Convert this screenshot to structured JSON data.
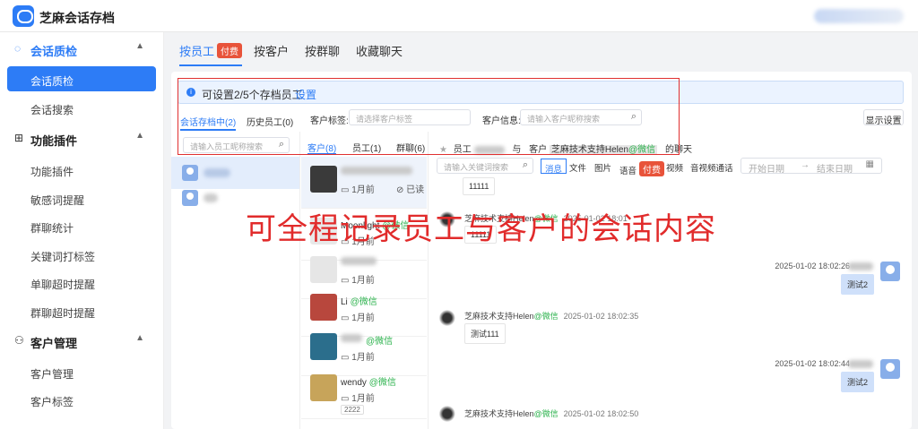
{
  "app": {
    "title": "芝麻会话存档"
  },
  "sidebar": {
    "sections": [
      {
        "label": "会话质检",
        "icon": "chat-icon",
        "items": [
          "会话质检",
          "会话搜索"
        ]
      },
      {
        "label": "功能插件",
        "icon": "grid-icon",
        "items": [
          "功能插件",
          "敏感词提醒",
          "群聊统计",
          "关键词打标签",
          "单聊超时提醒",
          "群聊超时提醒"
        ]
      },
      {
        "label": "客户管理",
        "icon": "user-icon",
        "items": [
          "客户管理",
          "客户标签"
        ]
      }
    ]
  },
  "tabs": [
    {
      "label": "按员工",
      "badge": "付费"
    },
    {
      "label": "按客户"
    },
    {
      "label": "按群聊"
    },
    {
      "label": "收藏聊天"
    }
  ],
  "notice": {
    "text": "可设置2/5个存档员工",
    "link": "设置"
  },
  "employee_tabs": [
    "会话存档中(2)",
    "历史员工(0)"
  ],
  "filters": {
    "tag_label": "客户标签:",
    "tag_placeholder": "请选择客户标签",
    "info_label": "客户信息:",
    "info_placeholder": "请输入客户昵称搜索",
    "display_button": "显示设置"
  },
  "employee_search_placeholder": "请输入员工昵称搜索",
  "customer_tabs": [
    "客户(8)",
    "员工(1)",
    "群聊(6)"
  ],
  "customers": [
    {
      "name": "",
      "time": "1月前",
      "status": "已读"
    },
    {
      "name": "Moonlight",
      "tag": "@微信",
      "time": "1月前"
    },
    {
      "name": "",
      "time": "1月前"
    },
    {
      "name": "Li",
      "tag": "@微信",
      "time": "1月前"
    },
    {
      "name": "",
      "tag": "@微信",
      "time": "1月前"
    },
    {
      "name": "wendy",
      "tag": "@微信",
      "time": "1月前",
      "label": "2222"
    }
  ],
  "chat_header": {
    "employee_prefix": "员工",
    "with": "与",
    "customer_prefix": "客户",
    "customer": "芝麻技术支持Helen",
    "customer_tag": "@微信",
    "suffix": "的聊天"
  },
  "msg_search_placeholder": "请输入关键词搜索",
  "msg_types": [
    "消息",
    "文件",
    "图片",
    "语音",
    "付费",
    "视频",
    "音视频通话"
  ],
  "date_range": {
    "start": "开始日期",
    "sep": "→",
    "end": "结束日期"
  },
  "messages": [
    {
      "text": "11111"
    },
    {
      "sender": "芝麻技术支持Helen",
      "tag": "@微信",
      "time": "2025-01-02 18:01",
      "text": "11111"
    },
    {
      "mine": true,
      "time": "2025-01-02 18:02:26",
      "text": "测试2"
    },
    {
      "sender": "芝麻技术支持Helen",
      "tag": "@微信",
      "time": "2025-01-02 18:02:35",
      "text": "测试111"
    },
    {
      "mine": true,
      "time": "2025-01-02 18:02:44",
      "text": "测试2"
    },
    {
      "sender": "芝麻技术支持Helen",
      "tag": "@微信",
      "time": "2025-01-02 18:02:50"
    }
  ],
  "overlay": "可全程记录员工与客户的会话内容",
  "colors": {
    "accent": "#2d7cf6",
    "badge": "#e8533a",
    "wechat": "#2bb24c",
    "annotation": "#e12b2b"
  }
}
